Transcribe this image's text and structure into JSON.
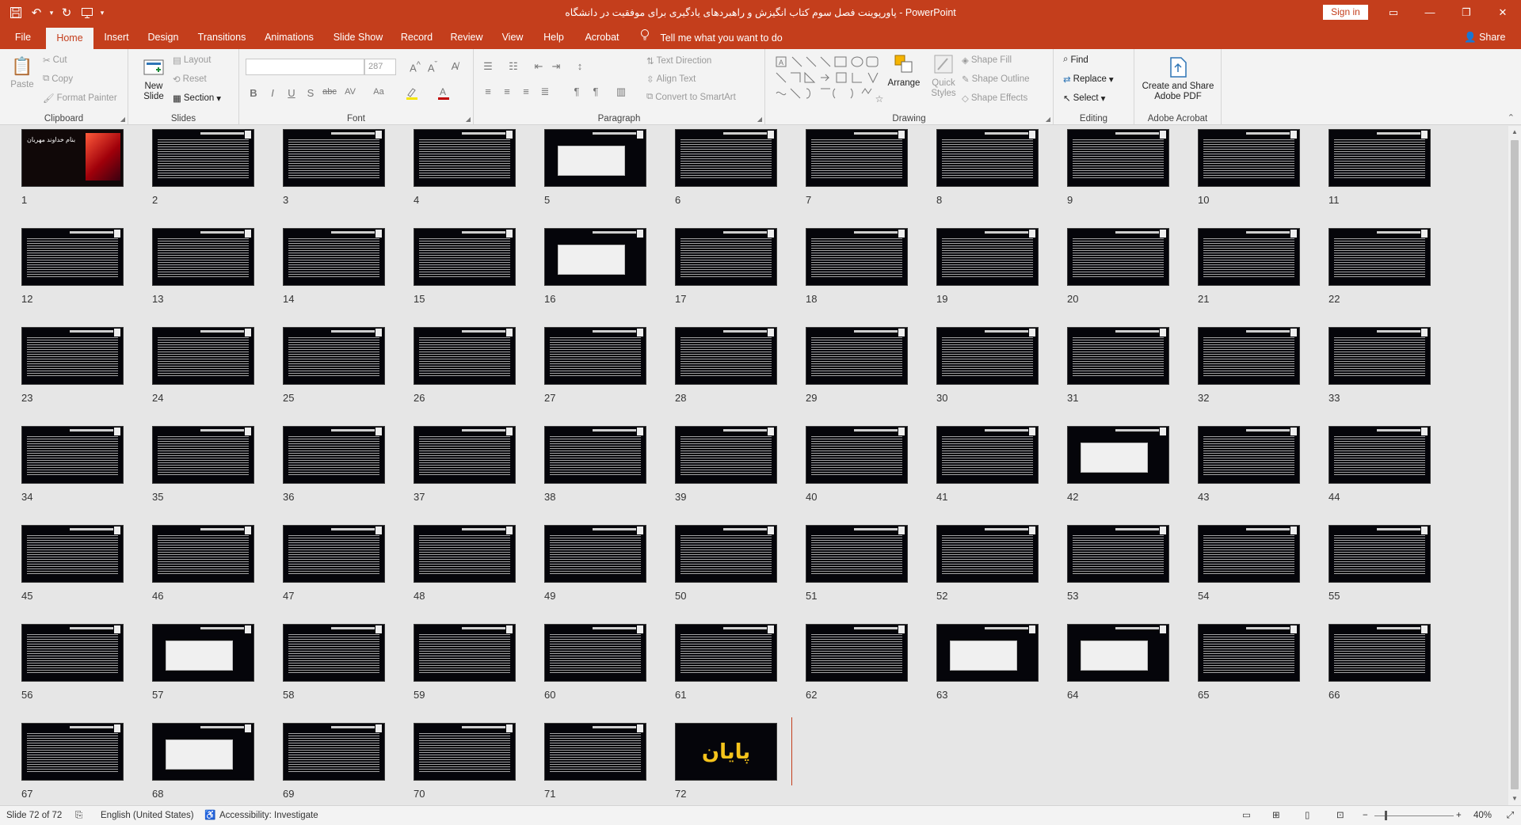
{
  "window": {
    "title": "پاورپوینت فصل سوم کتاب انگیزش و راهبردهای یادگیری برای موفقیت در دانشگاه  -  PowerPoint",
    "sign_in": "Sign in",
    "qat_icons": [
      "save-icon",
      "undo-icon",
      "redo-icon",
      "start-from-beginning-icon",
      "customize-qat-icon"
    ],
    "controls": [
      "ribbon-display-icon",
      "minimize-icon",
      "maximize-icon",
      "close-icon"
    ]
  },
  "menu": {
    "tabs": [
      "File",
      "Home",
      "Insert",
      "Design",
      "Transitions",
      "Animations",
      "Slide Show",
      "Record",
      "Review",
      "View",
      "Help",
      "Acrobat"
    ],
    "active_tab": "Home",
    "tell_me": "Tell me what you want to do",
    "share": "Share"
  },
  "ribbon": {
    "clipboard": {
      "label": "Clipboard",
      "paste": "Paste",
      "cut": "Cut",
      "copy": "Copy",
      "format_painter": "Format Painter"
    },
    "slides": {
      "label": "Slides",
      "new_slide": "New Slide",
      "layout": "Layout",
      "reset": "Reset",
      "section": "Section"
    },
    "font": {
      "label": "Font",
      "size_value": "287",
      "buttons": [
        "B",
        "I",
        "U",
        "S",
        "abc",
        "AV",
        "Aa"
      ]
    },
    "paragraph": {
      "label": "Paragraph",
      "text_direction": "Text Direction",
      "align_text": "Align Text",
      "convert_smartart": "Convert to SmartArt"
    },
    "drawing": {
      "label": "Drawing",
      "arrange": "Arrange",
      "quick_styles": "Quick Styles",
      "shape_fill": "Shape Fill",
      "shape_outline": "Shape Outline",
      "shape_effects": "Shape Effects"
    },
    "editing": {
      "label": "Editing",
      "find": "Find",
      "replace": "Replace",
      "select": "Select"
    },
    "acrobat": {
      "label": "Adobe Acrobat",
      "create_share": "Create and Share Adobe PDF"
    }
  },
  "slides": {
    "count": 72,
    "image_slides": [
      5,
      16,
      42,
      57,
      63,
      64,
      68
    ],
    "title_slide_text": "بنام خداوند مهربان",
    "last_slide_text": "پایان"
  },
  "status": {
    "slide_info": "Slide 72 of 72",
    "language": "English (United States)",
    "accessibility": "Accessibility: Investigate",
    "zoom": "40%"
  },
  "colors": {
    "accent": "#c43e1c",
    "slide_bg": "#05050a",
    "end_text": "#f5c31b"
  }
}
